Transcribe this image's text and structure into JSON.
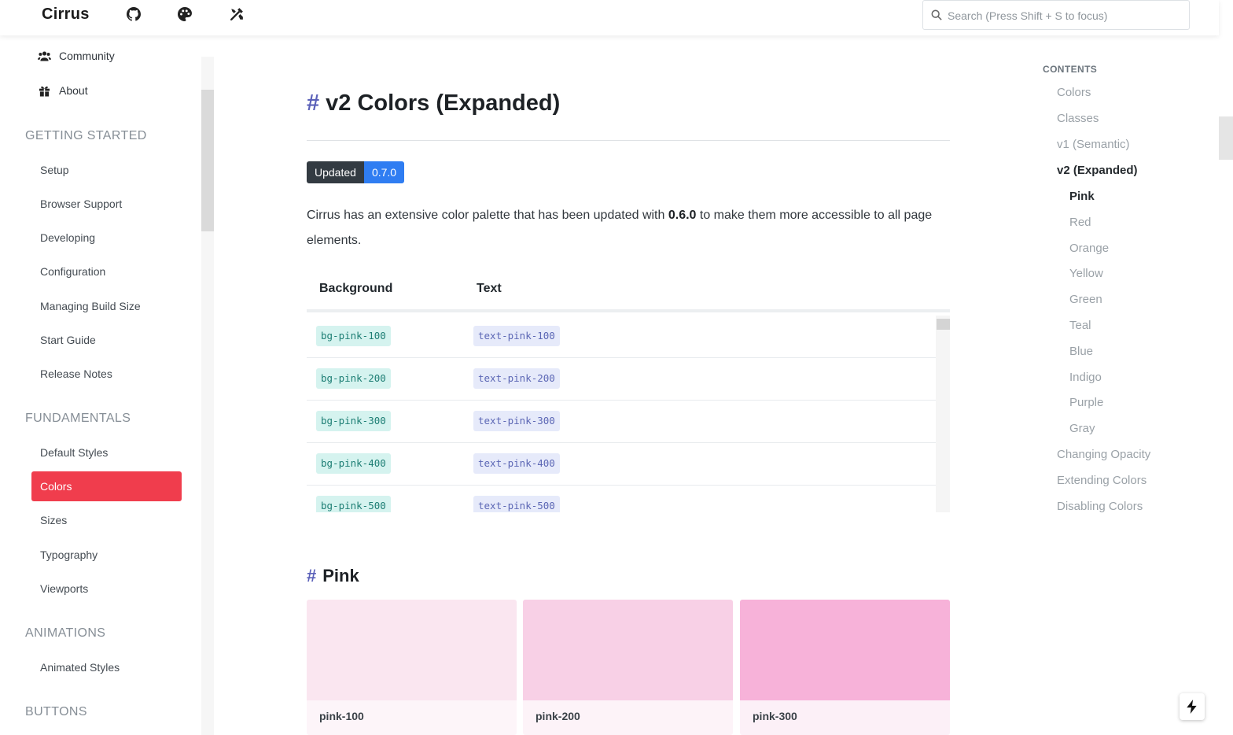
{
  "brand": "Cirrus",
  "header_icons": [
    "github-icon",
    "palette-icon",
    "tools-icon"
  ],
  "search": {
    "placeholder": "Search (Press Shift + S to focus)"
  },
  "sidebar": {
    "top_items": [
      {
        "label": "Community",
        "icon": "users-icon"
      },
      {
        "label": "About",
        "icon": "gift-icon"
      }
    ],
    "sections": [
      {
        "title": "GETTING STARTED",
        "items": [
          "Setup",
          "Browser Support",
          "Developing",
          "Configuration",
          "Managing Build Size",
          "Start Guide",
          "Release Notes"
        ]
      },
      {
        "title": "FUNDAMENTALS",
        "items": [
          "Default Styles",
          "Colors",
          "Sizes",
          "Typography",
          "Viewports"
        ]
      },
      {
        "title": "ANIMATIONS",
        "items": [
          "Animated Styles"
        ]
      },
      {
        "title": "BUTTONS",
        "items": []
      }
    ],
    "active_item": "Colors"
  },
  "main": {
    "title": "v2 Colors (Expanded)",
    "hash": "#",
    "badge": {
      "label": "Updated",
      "version": "0.7.0"
    },
    "intro_pre": "Cirrus has an extensive color palette that has been updated with ",
    "intro_bold": "0.6.0",
    "intro_post": " to make them more accessible to all page elements.",
    "table": {
      "headers": [
        "Background",
        "Text"
      ],
      "rows": [
        [
          "bg-pink-100",
          "text-pink-100"
        ],
        [
          "bg-pink-200",
          "text-pink-200"
        ],
        [
          "bg-pink-300",
          "text-pink-300"
        ],
        [
          "bg-pink-400",
          "text-pink-400"
        ],
        [
          "bg-pink-500",
          "text-pink-500"
        ]
      ]
    },
    "section_title": "Pink",
    "swatches": [
      {
        "label": "pink-100",
        "color": "#fae6f0",
        "label_bg": "#fdf5f9"
      },
      {
        "label": "pink-200",
        "color": "#f8d0e6",
        "label_bg": "#fdf3f8"
      },
      {
        "label": "pink-300",
        "color": "#f7b2d9",
        "label_bg": "#fcf0f7"
      }
    ]
  },
  "toc": {
    "title": "CONTENTS",
    "items": [
      {
        "label": "Colors",
        "level": 1
      },
      {
        "label": "Classes",
        "level": 1
      },
      {
        "label": "v1 (Semantic)",
        "level": 1
      },
      {
        "label": "v2 (Expanded)",
        "level": 1,
        "active": true
      },
      {
        "label": "Pink",
        "level": 2,
        "active": true
      },
      {
        "label": "Red",
        "level": 2
      },
      {
        "label": "Orange",
        "level": 2
      },
      {
        "label": "Yellow",
        "level": 2
      },
      {
        "label": "Green",
        "level": 2
      },
      {
        "label": "Teal",
        "level": 2
      },
      {
        "label": "Blue",
        "level": 2
      },
      {
        "label": "Indigo",
        "level": 2
      },
      {
        "label": "Purple",
        "level": 2
      },
      {
        "label": "Gray",
        "level": 2
      },
      {
        "label": "Changing Opacity",
        "level": 1
      },
      {
        "label": "Extending Colors",
        "level": 1
      },
      {
        "label": "Disabling Colors",
        "level": 1
      }
    ]
  },
  "colors": {
    "accent": "#f03d4d",
    "hash": "#5b61b9",
    "badge_dark": "#333b42",
    "badge_blue": "#2f7df2"
  }
}
